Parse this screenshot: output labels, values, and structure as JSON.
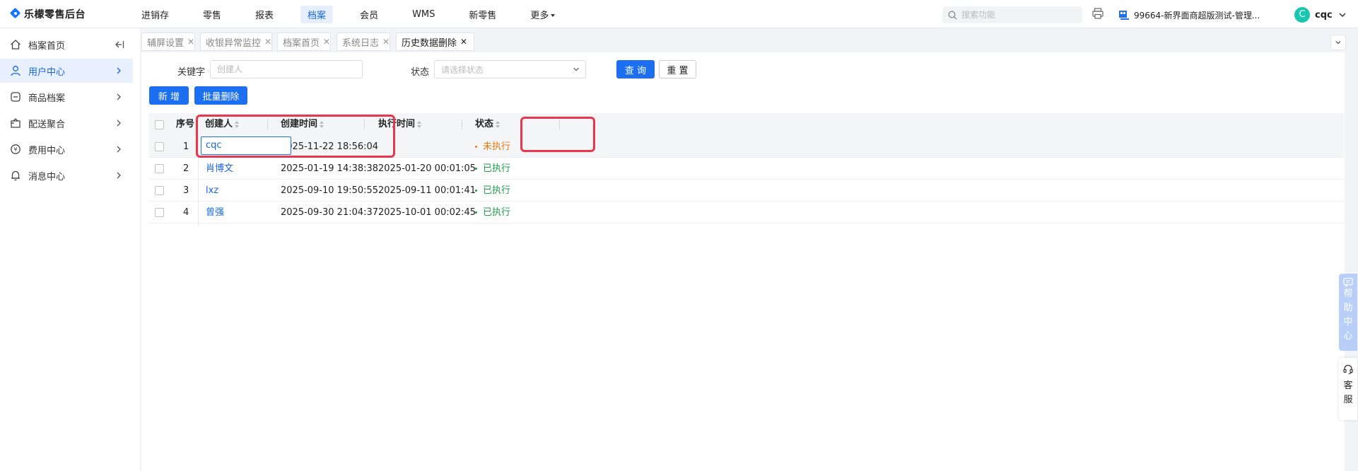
{
  "header": {
    "logo_text": "乐檬零售后台",
    "nav": [
      "进销存",
      "零售",
      "报表",
      "档案",
      "会员",
      "WMS",
      "新零售",
      "更多"
    ],
    "active_nav": "档案",
    "search_placeholder": "搜索功能",
    "store_name": "99664-新界面商超版测试-管理...",
    "avatar_letter": "C",
    "username": "cqc"
  },
  "sidebar": {
    "items": [
      {
        "label": "档案首页",
        "icon": "home-icon"
      },
      {
        "label": "用户中心",
        "icon": "user-icon"
      },
      {
        "label": "商品档案",
        "icon": "product-icon"
      },
      {
        "label": "配送聚合",
        "icon": "delivery-icon"
      },
      {
        "label": "费用中心",
        "icon": "fee-icon"
      },
      {
        "label": "消息中心",
        "icon": "bell-icon"
      }
    ],
    "active_index": 1
  },
  "tabs": [
    {
      "label": "辅屏设置"
    },
    {
      "label": "收银异常监控"
    },
    {
      "label": "档案首页"
    },
    {
      "label": "系统日志"
    },
    {
      "label": "历史数据删除"
    }
  ],
  "active_tab": "历史数据删除",
  "filters": {
    "keyword_label": "关键字",
    "keyword_placeholder": "创建人",
    "status_label": "状态",
    "status_placeholder": "请选择状态",
    "query_button": "查 询",
    "reset_button": "重 置"
  },
  "actions": {
    "add_button": "新 增",
    "batch_delete_button": "批量删除"
  },
  "table": {
    "headers": {
      "seq": "序号",
      "creator": "创建人",
      "created_at": "创建时间",
      "executed_at": "执行时间",
      "status": "状态"
    },
    "rows": [
      {
        "seq": "1",
        "creator": "cqc",
        "created_at": "2025-11-22 18:56:04",
        "executed_at": "",
        "status": "未执行"
      },
      {
        "seq": "2",
        "creator": "肖博文",
        "created_at": "2025-01-19 14:38:38",
        "executed_at": "2025-01-20 00:01:05",
        "status": "已执行"
      },
      {
        "seq": "3",
        "creator": "lxz",
        "created_at": "2025-09-10 19:50:55",
        "executed_at": "2025-09-11 00:01:41",
        "status": "已执行"
      },
      {
        "seq": "4",
        "creator": "曾强",
        "created_at": "2025-09-30 21:04:37",
        "executed_at": "2025-10-01 00:02:45",
        "status": "已执行"
      }
    ]
  },
  "floating": {
    "help_text": [
      "帮",
      "助",
      "中",
      "心"
    ],
    "service_text": [
      "客",
      "服"
    ]
  },
  "colors": {
    "primary": "#1b6ff0",
    "status_done": "#1f9a4a",
    "status_pending": "#e8780c",
    "annotation": "#e8364e"
  }
}
